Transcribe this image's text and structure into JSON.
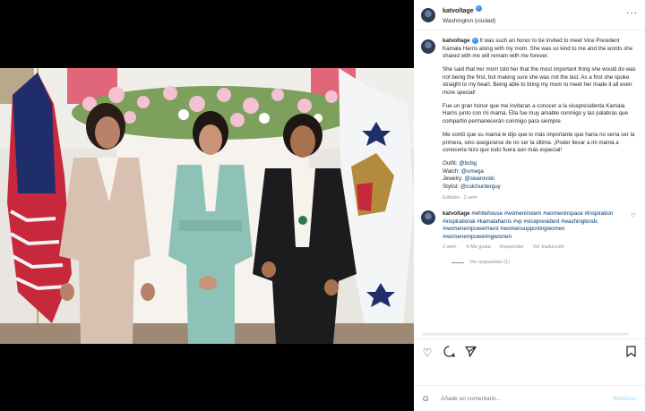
{
  "post": {
    "username": "katvoltage",
    "location": "Washington (ciudad)",
    "more_icon": "more-horizontal-icon"
  },
  "caption": {
    "p1": "It was such an honor to be invited to meet Vice President Kamala Harris along with my mom. She was so kind to me and the words she shared with me will remain with me forever.",
    "p2": "She said that her mom told her that the most important thing she would do was not being the first, but making sure she was not the last. As a first she spoke straight to my heart. Being able to bring my mom to meet her made it all even more special!",
    "p3": "Fue un gran honor que me invitaran a conocer a la vicepresidenta Kamala Harris junto con mi mamá. Ella fue muy amable conmigo y las palabras que compartió permanecerán conmigo para siempre.",
    "p4": "Me contó que su mamá le dijo que lo más importante que haría no sería ser la primera, sino asegurarse de no ser la última. ¡Poder llevar a mi mamá a conocerla hizo que todo fuera aún más especial!",
    "outfit_label": "Outfit:",
    "outfit_tag": "@bcbg",
    "watch_label": "Watch:",
    "watch_tag": "@omega",
    "jewelry_label": "Jewelry:",
    "jewelry_tag": "@swarovski",
    "stylist_label": "Stylist:",
    "stylist_tag": "@colchunterguy",
    "edited": "Editado · 2 sem"
  },
  "reply": {
    "username": "katvoltage",
    "text": "#whitehouse #womeninstem #womeninspace #inspiration #inspirational #kamalaharris #vp #vicepresident #washingtondc #womenempowerment #womensupportingwomen #womenempoweringwomen",
    "time": "2 sem.",
    "likes": "6 Me gusta",
    "reply_btn": "Responder",
    "translate_btn": "Ver traducción",
    "view_replies": "Ver respuestas (1)"
  },
  "actions": {
    "like_icon": "heart-icon",
    "comment_icon": "comment-icon",
    "share_icon": "send-icon",
    "save_icon": "bookmark-icon"
  },
  "composer": {
    "emoji_icon": "emoji-icon",
    "placeholder": "Añade un comentario...",
    "publish": "Publicar"
  },
  "colors": {
    "link": "#00376b",
    "verified": "#3897f0",
    "muted": "#8e8e8e"
  }
}
